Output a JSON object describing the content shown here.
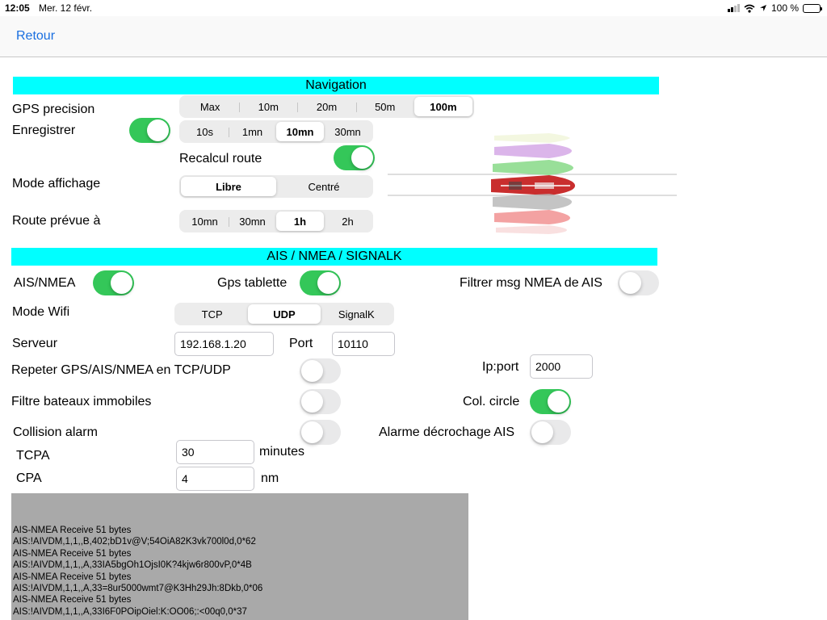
{
  "status_bar": {
    "time": "12:05",
    "date": "Mer. 12 févr.",
    "battery": "100 %"
  },
  "nav": {
    "back_label": "Retour"
  },
  "navigation": {
    "title": "Navigation",
    "gps_precision": {
      "label": "GPS precision",
      "options": [
        "Max",
        "10m",
        "20m",
        "50m",
        "100m"
      ],
      "selected": "100m"
    },
    "enregistrer": {
      "label": "Enregistrer",
      "on": true,
      "options": [
        "10s",
        "1mn",
        "10mn",
        "30mn"
      ],
      "selected": "10mn"
    },
    "recalcul_route": {
      "label": "Recalcul route",
      "on": true
    },
    "mode_affichage": {
      "label": "Mode affichage",
      "options": [
        "Libre",
        "Centré"
      ],
      "selected": "Libre"
    },
    "route_prevue": {
      "label": "Route prévue à",
      "options": [
        "10mn",
        "30mn",
        "1h",
        "2h"
      ],
      "selected": "1h"
    }
  },
  "ais": {
    "title": "AIS / NMEA / SIGNALK",
    "ais_nmea": {
      "label": "AIS/NMEA",
      "on": true
    },
    "gps_tablette": {
      "label": "Gps tablette",
      "on": true
    },
    "filtrer": {
      "label": "Filtrer msg NMEA de AIS",
      "on": false
    },
    "mode_wifi": {
      "label": "Mode Wifi",
      "options": [
        "TCP",
        "UDP",
        "SignalK"
      ],
      "selected": "UDP"
    },
    "serveur": {
      "label": "Serveur",
      "value": "192.168.1.20"
    },
    "port": {
      "label": "Port",
      "value": "10110"
    },
    "repeter": {
      "label": "Repeter GPS/AIS/NMEA en TCP/UDP",
      "on": false
    },
    "ip_port": {
      "label": "Ip:port",
      "value": "2000"
    },
    "filtre_bateaux": {
      "label": "Filtre bateaux immobiles",
      "on": false
    },
    "col_circle": {
      "label": "Col. circle",
      "on": true
    },
    "collision_alarm": {
      "label": "Collision alarm",
      "on": false
    },
    "alarme_decrochage": {
      "label": "Alarme décrochage AIS",
      "on": false
    },
    "tcpa": {
      "label": "TCPA",
      "value": "30",
      "unit": "minutes"
    },
    "cpa": {
      "label": "CPA",
      "value": "4",
      "unit": "nm"
    }
  },
  "log": [
    "AIS-NMEA Receive 51 bytes",
    "AIS:!AIVDM,1,1,,B,402;bD1v@V;54OiA82K3vk700l0d,0*62",
    "AIS-NMEA Receive 51 bytes",
    "AIS:!AIVDM,1,1,,A,33IA5bgOh1OjsI0K?4kjw6r800vP,0*4B",
    "AIS-NMEA Receive 51 bytes",
    "AIS:!AIVDM,1,1,,A,33=8ur5000wmt7@K3Hh29Jh:8Dkb,0*06",
    "AIS-NMEA Receive 51 bytes",
    "AIS:!AIVDM,1,1,,A,33I6F0POipOiel:K:OO06;:<00q0,0*37"
  ],
  "colors": {
    "section": "#00ffff",
    "switch_on": "#34c759",
    "link": "#1a6fe0",
    "log_bg": "#a9a9a9"
  }
}
